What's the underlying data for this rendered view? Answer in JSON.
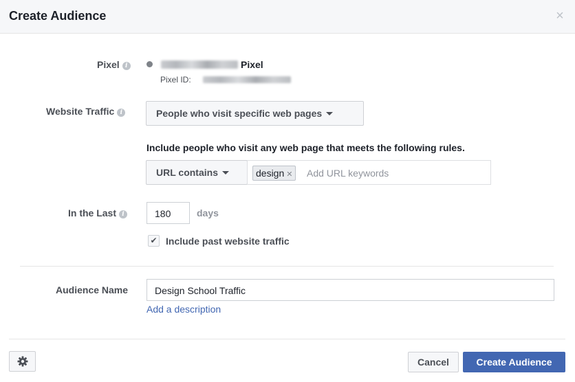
{
  "dialog": {
    "title": "Create Audience",
    "close_glyph": "×"
  },
  "pixel": {
    "label": "Pixel",
    "name_suffix": "Pixel",
    "id_label": "Pixel ID:"
  },
  "website_traffic": {
    "label": "Website Traffic",
    "selected_option": "People who visit specific web pages"
  },
  "rules": {
    "description": "Include people who visit any web page that meets the following rules.",
    "condition": "URL contains",
    "keywords": [
      "design"
    ],
    "placeholder": "Add URL keywords"
  },
  "timeframe": {
    "label": "In the Last",
    "value": "180",
    "unit": "days",
    "include_past_label": "Include past website traffic",
    "include_past_checked": true
  },
  "audience": {
    "name_label": "Audience Name",
    "name_value": "Design School Traffic",
    "add_description_link": "Add a description"
  },
  "footer": {
    "settings_icon": "gear-icon",
    "cancel_label": "Cancel",
    "create_label": "Create Audience"
  },
  "colors": {
    "primary": "#4267b2",
    "header_bg": "#f6f7f9",
    "label_text": "#4b4f56"
  }
}
